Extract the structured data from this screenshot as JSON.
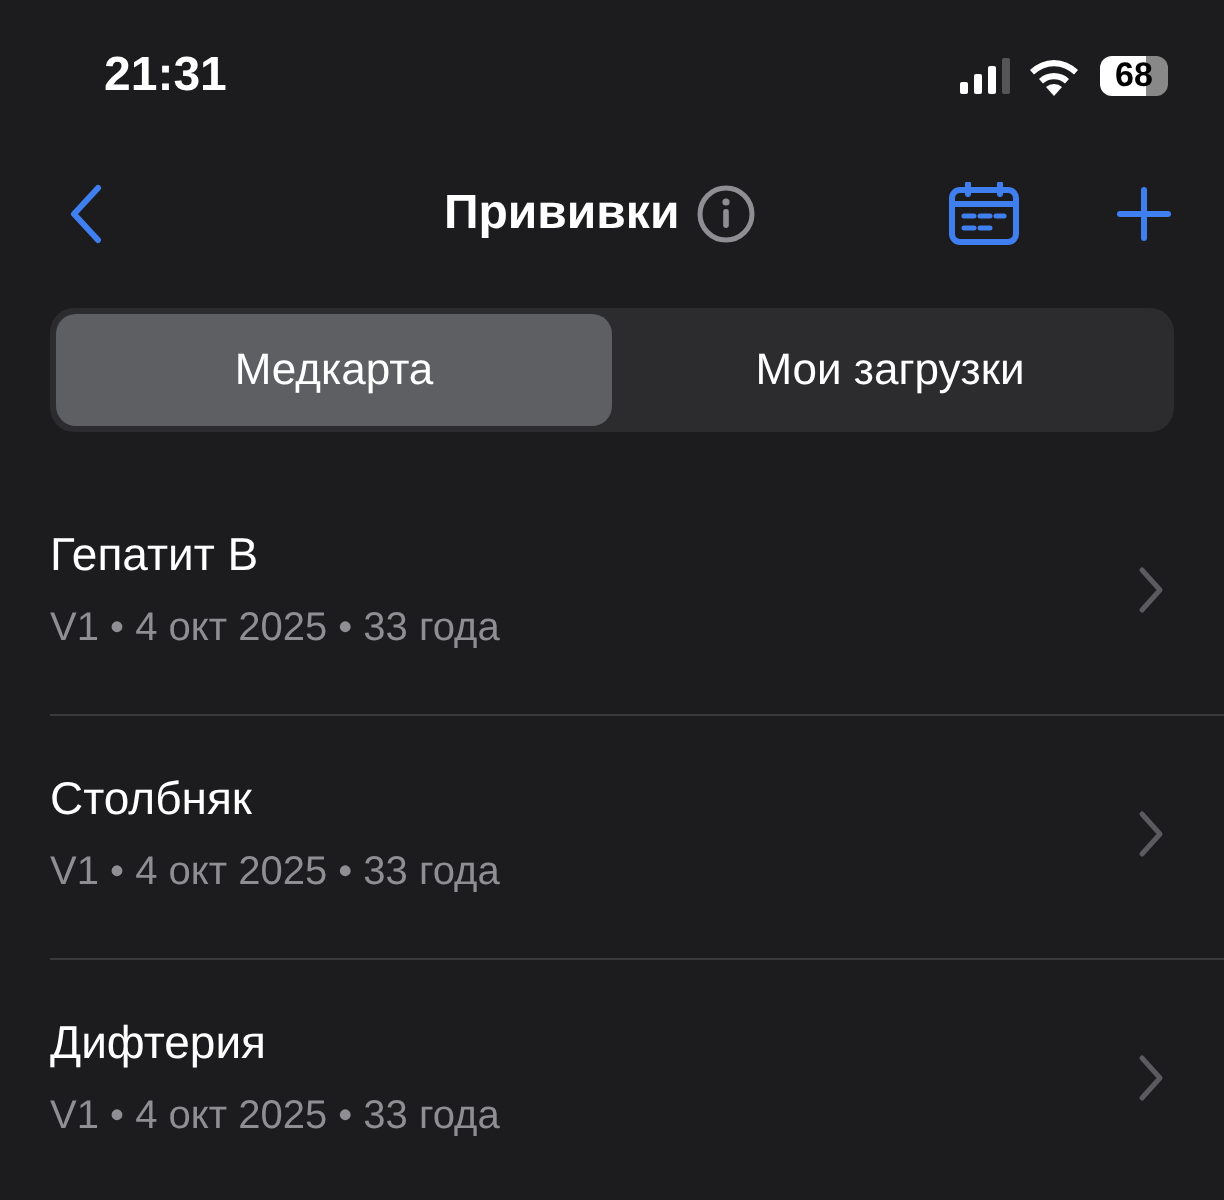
{
  "status_bar": {
    "time": "21:31",
    "battery": "68"
  },
  "nav": {
    "title": "Прививки"
  },
  "segments": [
    {
      "label": "Медкарта",
      "selected": true
    },
    {
      "label": "Мои загрузки",
      "selected": false
    }
  ],
  "items": [
    {
      "title": "Гепатит B",
      "subtitle": "V1 • 4 окт 2025 • 33 года"
    },
    {
      "title": "Столбняк",
      "subtitle": "V1 • 4 окт 2025 • 33 года"
    },
    {
      "title": "Дифтерия",
      "subtitle": "V1 • 4 окт 2025 • 33 года"
    }
  ]
}
